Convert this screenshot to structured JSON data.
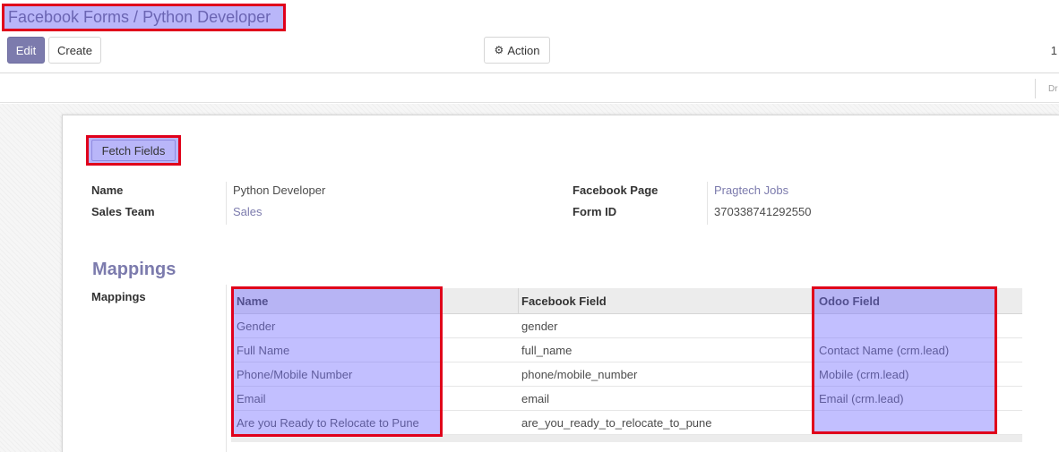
{
  "breadcrumb": {
    "parent": "Facebook Forms",
    "separator": "/",
    "current": "Python Developer"
  },
  "toolbar": {
    "edit_label": "Edit",
    "create_label": "Create",
    "action_label": "Action",
    "pager_text": "1"
  },
  "status": {
    "draft_label": "Dr"
  },
  "form": {
    "fetch_label": "Fetch Fields",
    "name_label": "Name",
    "name_value": "Python Developer",
    "sales_team_label": "Sales Team",
    "sales_team_value": "Sales",
    "page_label": "Facebook Page",
    "page_value": "Pragtech Jobs",
    "form_id_label": "Form ID",
    "form_id_value": "370338741292550"
  },
  "mappings": {
    "section_title": "Mappings",
    "field_label": "Mappings",
    "columns": [
      "Name",
      "Facebook Field",
      "Odoo Field"
    ],
    "rows": [
      [
        "Gender",
        "gender",
        ""
      ],
      [
        "Full Name",
        "full_name",
        "Contact Name (crm.lead)"
      ],
      [
        "Phone/Mobile Number",
        "phone/mobile_number",
        "Mobile (crm.lead)"
      ],
      [
        "Email",
        "email",
        "Email (crm.lead)"
      ],
      [
        "Are you Ready to Relocate to Pune",
        "are_you_ready_to_relocate_to_pune",
        ""
      ]
    ]
  },
  "icons": {
    "action_icon": "gear-icon"
  },
  "colors": {
    "primary": "#7c7bad",
    "highlight": "#b9b6f9",
    "annotation_border": "#e0001b"
  }
}
